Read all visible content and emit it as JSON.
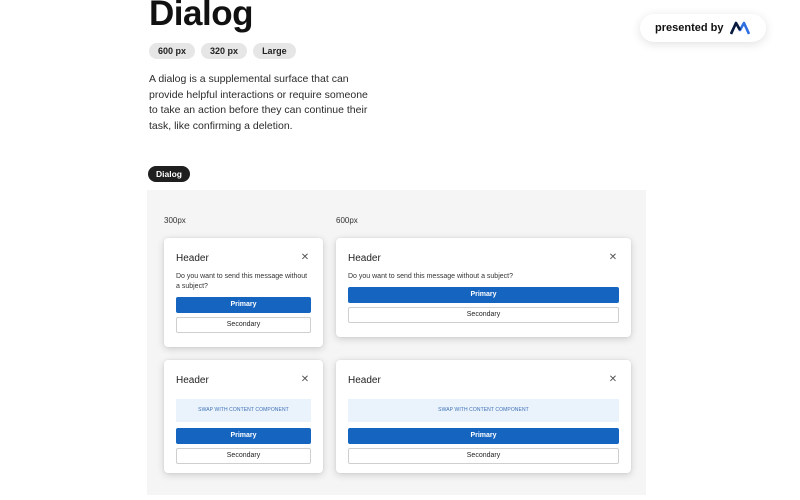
{
  "title": "Dialog",
  "tags": [
    "600 px",
    "320 px",
    "Large"
  ],
  "intro": "A dialog is a supplemental surface that can provide helpful interactions or require someone to take an action before they can continue their task, like confirming a deletion.",
  "presented_by": {
    "label": "presented by",
    "logo_icon": "brand-logo-icon"
  },
  "section": "Dialog",
  "size_labels": [
    "300px",
    "600px"
  ],
  "dialogs": [
    {
      "header": "Header",
      "body": "Do you want to send this message without a subject?",
      "primary": "Primary",
      "secondary": "Secondary"
    },
    {
      "header": "Header",
      "body": "Do you want to send this message without a subject?",
      "primary": "Primary",
      "secondary": "Secondary"
    },
    {
      "header": "Header",
      "swap": "SWAP WITH CONTENT COMPONENT",
      "primary": "Primary",
      "secondary": "Secondary"
    },
    {
      "header": "Header",
      "swap": "SWAP WITH CONTENT COMPONENT",
      "primary": "Primary",
      "secondary": "Secondary"
    }
  ],
  "close_icon": "close-icon",
  "colors": {
    "primary": "#1565c0",
    "swap_bg": "#eaf3fc",
    "pill_dark": "#1f1f1f"
  }
}
